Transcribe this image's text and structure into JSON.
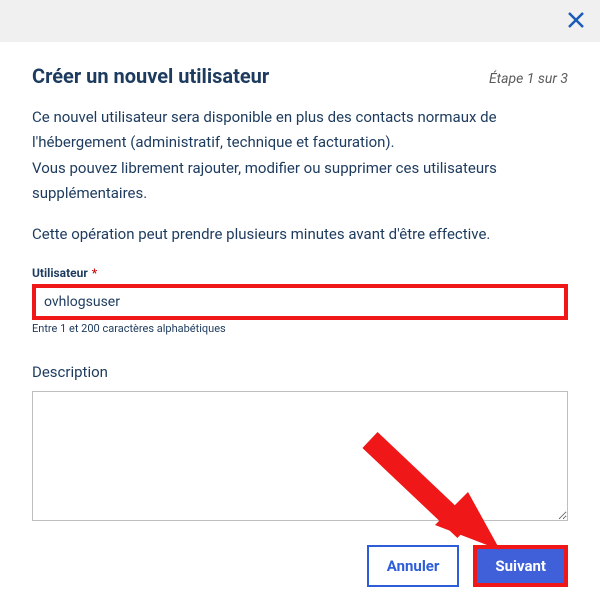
{
  "header": {
    "title": "Créer un nouvel utilisateur",
    "step": "Étape 1 sur 3"
  },
  "body": {
    "paragraph1_line1": "Ce nouvel utilisateur sera disponible en plus des contacts normaux de",
    "paragraph1_line2": "l'hébergement (administratif, technique et facturation).",
    "paragraph1_line3": "Vous pouvez librement rajouter, modifier ou supprimer ces utilisateurs",
    "paragraph1_line4": "supplémentaires.",
    "paragraph2": "Cette opération peut prendre plusieurs minutes avant d'être effective."
  },
  "fields": {
    "user_label": "Utilisateur",
    "required_mark": "*",
    "user_value": "ovhlogsuser",
    "user_hint": "Entre 1 et 200 caractères alphabétiques",
    "description_label": "Description",
    "description_value": ""
  },
  "buttons": {
    "cancel": "Annuler",
    "next": "Suivant"
  }
}
